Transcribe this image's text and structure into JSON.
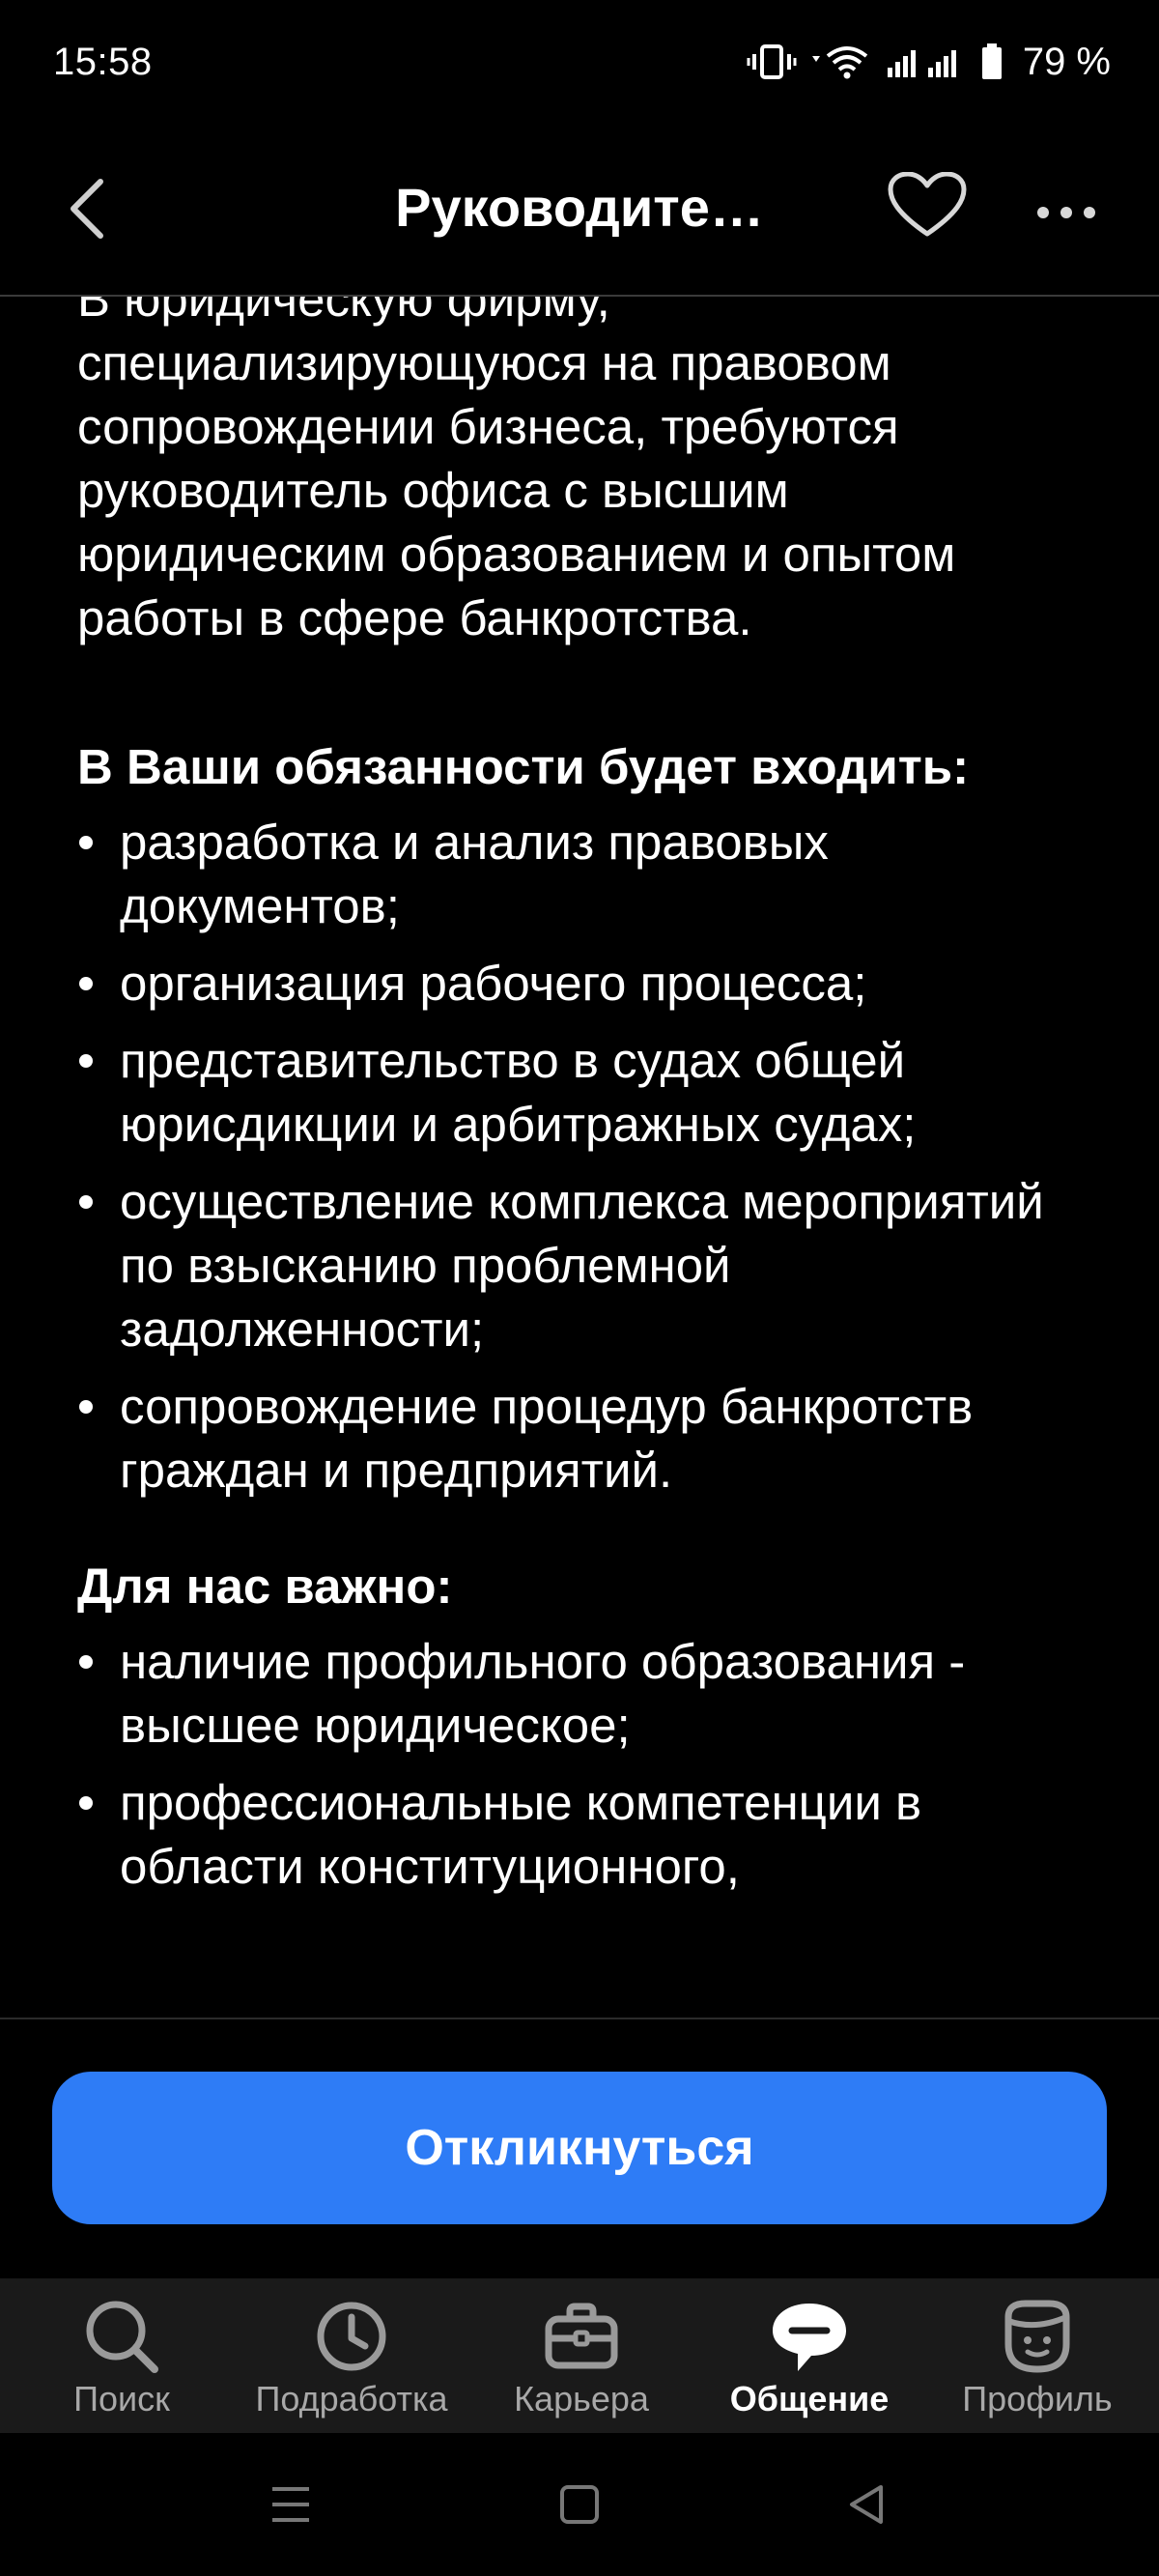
{
  "status": {
    "time": "15:58",
    "battery": "79 %"
  },
  "header": {
    "title": "Руководите…"
  },
  "content": {
    "intro": "В юридическую фирму, специализирующуюся на правовом сопровождении бизнеса, требуются руководитель офиса с высшим юридическим образованием и опытом работы в сфере банкротства.",
    "duties_heading": "В Ваши обязанности будет входить:",
    "duties": [
      "разработка и анализ правовых документов;",
      "организация рабочего процесса;",
      "представительство в судах общей юрисдикции и арбитражных судах;",
      "осуществление комплекса мероприятий по взысканию проблемной задолженности;",
      "сопровождение процедур банкротств граждан и предприятий."
    ],
    "important_heading": "Для нас важно:",
    "important": [
      "наличие профильного образования - высшее юридическое;",
      "профессиональные компетенции в области конституционного,"
    ]
  },
  "apply_label": "Откликнуться",
  "tabs": [
    {
      "label": "Поиск",
      "icon": "search-icon"
    },
    {
      "label": "Подработка",
      "icon": "clock-icon"
    },
    {
      "label": "Карьера",
      "icon": "briefcase-icon"
    },
    {
      "label": "Общение",
      "icon": "chat-icon"
    },
    {
      "label": "Профиль",
      "icon": "profile-face-icon"
    }
  ],
  "colors": {
    "accent": "#2e7cf6",
    "background": "#000000",
    "tabbar": "#1a1a1a"
  }
}
